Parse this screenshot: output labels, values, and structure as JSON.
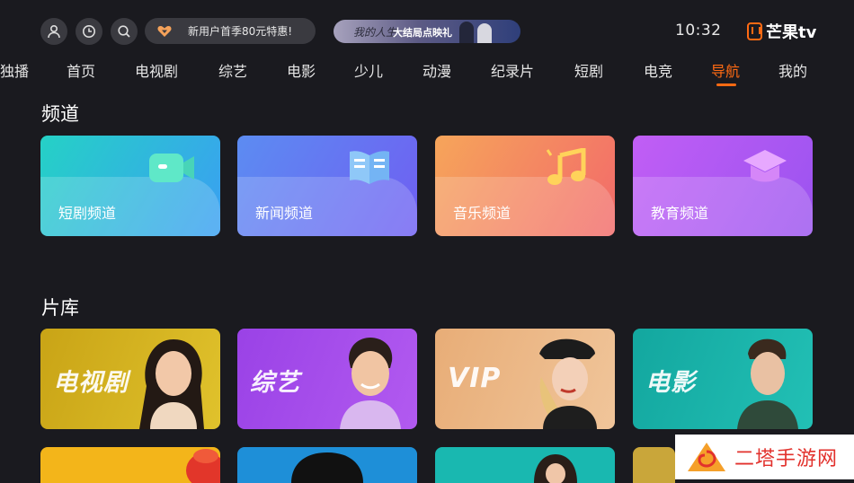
{
  "header": {
    "icons": [
      "user-icon",
      "history-clock-icon",
      "search-icon"
    ],
    "promo_text": "新用户首季80元特惠!",
    "banner_script": "我的人生",
    "banner_text": "大结局点映礼",
    "clock": "10:32",
    "logo_text": "芒果tv"
  },
  "nav": {
    "items": [
      "独播",
      "首页",
      "电视剧",
      "综艺",
      "电影",
      "少儿",
      "动漫",
      "纪录片",
      "短剧",
      "电竞",
      "导航",
      "我的"
    ],
    "active": "导航",
    "accent": "#ff6a13"
  },
  "channels": {
    "title": "频道",
    "cards": [
      {
        "label": "短剧频道",
        "icon": "camera-icon",
        "colors": [
          "#25d1c6",
          "#3a9ff2"
        ]
      },
      {
        "label": "新闻频道",
        "icon": "newspaper-icon",
        "colors": [
          "#5c8cf2",
          "#6f5ff2"
        ]
      },
      {
        "label": "音乐频道",
        "icon": "music-note-icon",
        "colors": [
          "#f6a55a",
          "#f26a6a"
        ]
      },
      {
        "label": "教育频道",
        "icon": "graduation-cap-icon",
        "colors": [
          "#c15ef5",
          "#9b53f0"
        ]
      }
    ]
  },
  "library": {
    "title": "片库",
    "cards": [
      {
        "label": "电视剧",
        "color": "#d9b21a"
      },
      {
        "label": "综艺",
        "color": "#a94be8"
      },
      {
        "label": "VIP",
        "color": "#e7b27f"
      },
      {
        "label": "电影",
        "color": "#17b6ad"
      }
    ],
    "row3_colors": [
      "#f3b51a",
      "#1e8fd8",
      "#19b8b0",
      "#c9a63a"
    ]
  },
  "watermark": {
    "text": "二塔手游网"
  }
}
